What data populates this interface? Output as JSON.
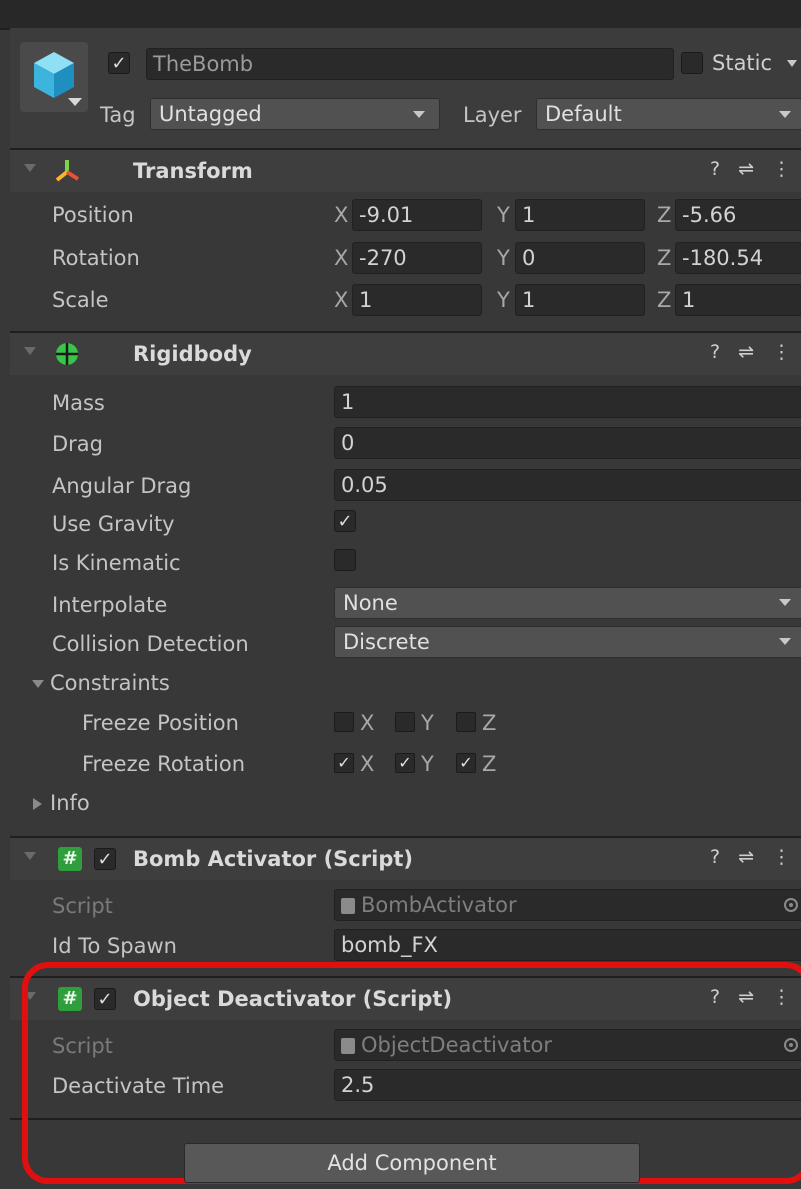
{
  "header": {
    "name": "TheBomb",
    "active": true,
    "static_label": "Static",
    "tag_label": "Tag",
    "tag_value": "Untagged",
    "layer_label": "Layer",
    "layer_value": "Default"
  },
  "transform": {
    "title": "Transform",
    "rows": [
      {
        "label": "Position",
        "x": "-9.01",
        "y": "1",
        "z": "-5.66"
      },
      {
        "label": "Rotation",
        "x": "-270",
        "y": "0",
        "z": "-180.54"
      },
      {
        "label": "Scale",
        "x": "1",
        "y": "1",
        "z": "1"
      }
    ],
    "axis": {
      "x": "X",
      "y": "Y",
      "z": "Z"
    }
  },
  "rigidbody": {
    "title": "Rigidbody",
    "mass_label": "Mass",
    "mass": "1",
    "drag_label": "Drag",
    "drag": "0",
    "angular_drag_label": "Angular Drag",
    "angular_drag": "0.05",
    "use_gravity_label": "Use Gravity",
    "use_gravity": true,
    "is_kinematic_label": "Is Kinematic",
    "is_kinematic": false,
    "interpolate_label": "Interpolate",
    "interpolate": "None",
    "collision_label": "Collision Detection",
    "collision": "Discrete",
    "constraints_label": "Constraints",
    "freeze_position_label": "Freeze Position",
    "freeze_rotation_label": "Freeze Rotation",
    "info_label": "Info"
  },
  "bomb_activator": {
    "title": "Bomb Activator (Script)",
    "script_label": "Script",
    "script": "BombActivator",
    "id_label": "Id To Spawn",
    "id": "bomb_FX"
  },
  "object_deactivator": {
    "title": "Object Deactivator (Script)",
    "script_label": "Script",
    "script": "ObjectDeactivator",
    "time_label": "Deactivate Time",
    "time": "2.5"
  },
  "add_component": "Add Component",
  "colors": {
    "highlight": "#e01010",
    "script_icon": "#2f9e3d",
    "background": "#383838"
  },
  "icons": {
    "help": "?",
    "presets": "⇌",
    "menu": "⋮",
    "check": "✓"
  }
}
